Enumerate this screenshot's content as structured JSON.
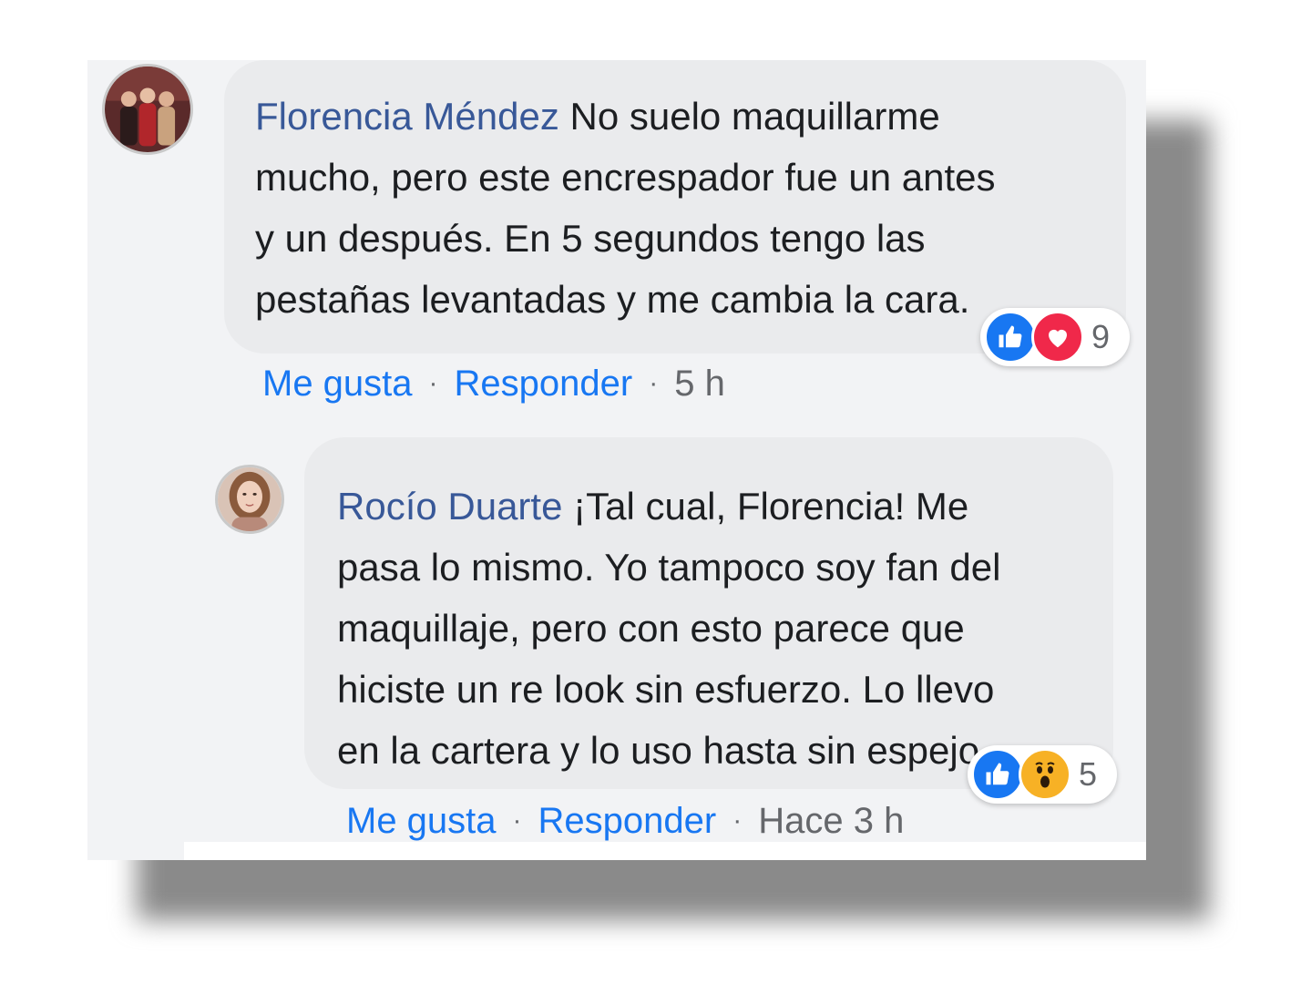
{
  "comments": [
    {
      "author": "Florencia Méndez",
      "lines": [
        " No suelo maquillarme",
        "mucho, pero este encrespador fue un antes",
        "y un después. En 5 segundos tengo las",
        "pestañas levantadas y me cambia la cara."
      ],
      "reactions": {
        "icons": [
          "like-icon",
          "love-icon"
        ],
        "count": "9"
      },
      "like_label": "Me gusta",
      "reply_label": "Responder",
      "separator": "·",
      "time": "5 h"
    },
    {
      "author": "Rocío Duarte",
      "lines": [
        " ¡Tal cual, Florencia! Me",
        "pasa lo mismo. Yo tampoco soy fan del",
        "maquillaje, pero con esto parece que",
        "hiciste un re look sin esfuerzo. Lo llevo",
        "en la cartera y lo uso hasta sin espejo."
      ],
      "reactions": {
        "icons": [
          "like-icon",
          "wow-icon"
        ],
        "count": "5"
      },
      "like_label": "Me gusta",
      "reply_label": "Responder",
      "separator": "·",
      "time": "Hace 3 h"
    }
  ],
  "colors": {
    "author": "#385898",
    "link": "#1877f2",
    "muted": "#65676b",
    "bubble": "#eaebed",
    "like": "#1877f2",
    "love": "#f0284a",
    "wow": "#f7b125"
  }
}
